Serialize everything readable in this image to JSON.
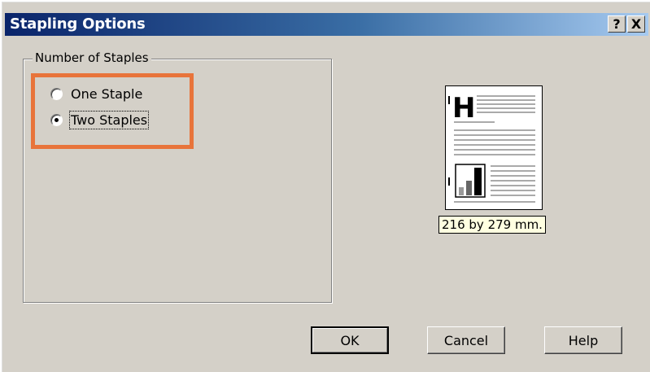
{
  "window": {
    "title": "Stapling Options",
    "help_button": "?",
    "close_button": "X"
  },
  "staples_group": {
    "label": "Number of Staples",
    "options": [
      {
        "label": "One Staple",
        "selected": false
      },
      {
        "label": "Two Staples",
        "selected": true
      }
    ]
  },
  "preview": {
    "size_label": "216 by 279 mm."
  },
  "buttons": {
    "ok": "OK",
    "cancel": "Cancel",
    "help": "Help"
  },
  "colors": {
    "highlight": "#e8743b",
    "title_bar": "#0a246a",
    "dialog_bg": "#d4d0c8"
  }
}
